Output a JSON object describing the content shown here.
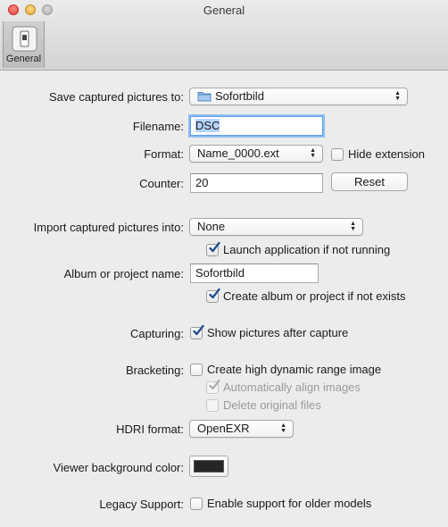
{
  "window": {
    "title": "General"
  },
  "toolbar": {
    "general_label": "General"
  },
  "save": {
    "label": "Save captured pictures to:",
    "value": "Sofortbild"
  },
  "filename": {
    "label": "Filename:",
    "value": "DSC"
  },
  "format": {
    "label": "Format:",
    "value": "Name_0000.ext",
    "hide_extension": "Hide extension"
  },
  "counter": {
    "label": "Counter:",
    "value": "20",
    "reset": "Reset"
  },
  "import": {
    "label": "Import captured pictures into:",
    "value": "None",
    "launch": "Launch application if not running"
  },
  "album": {
    "label": "Album or project name:",
    "value": "Sofortbild",
    "create": "Create album or project if not exists"
  },
  "capturing": {
    "label": "Capturing:",
    "show": "Show pictures after capture"
  },
  "bracketing": {
    "label": "Bracketing:",
    "hdr": "Create high dynamic range image",
    "align": "Automatically align images",
    "delete": "Delete original files"
  },
  "hdri": {
    "label": "HDRI format:",
    "value": "OpenEXR"
  },
  "viewer": {
    "label": "Viewer background color:",
    "color": "#262626"
  },
  "legacy": {
    "label": "Legacy Support:",
    "enable": "Enable support for older models"
  }
}
